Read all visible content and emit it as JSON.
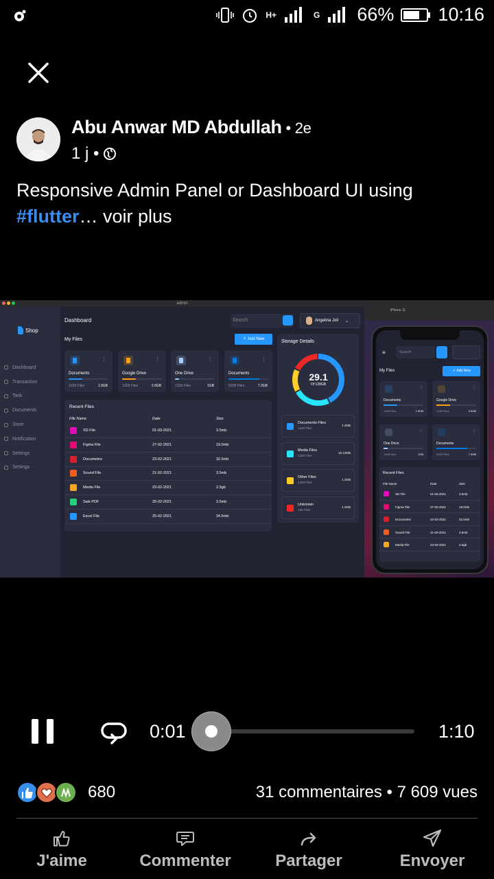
{
  "status_bar": {
    "battery": "66%",
    "time": "10:16",
    "network_1": "H+",
    "network_2": "G"
  },
  "post": {
    "author": "Abu Anwar MD Abdullah",
    "author_suffix": " • 2e",
    "age": "1 j •",
    "caption_text": "Responsive Admin Panel or Dashboard UI using",
    "hashtag": "#flutter",
    "see_more": "… voir plus"
  },
  "video": {
    "window_title": "admin",
    "desktop": {
      "logo": "Shop",
      "sidebar": [
        "Dashboard",
        "Transaction",
        "Task",
        "Documents",
        "Store",
        "Notification",
        "Settings",
        "Settings"
      ],
      "title": "Dashboard",
      "search_placeholder": "Search",
      "profile_name": "Angelina Joli",
      "my_files": "My Files",
      "add_new": "Add New",
      "cards": [
        {
          "name": "Documents",
          "files": "1328 Files",
          "size": "1.9GB",
          "color": "#2697ff",
          "progress": 0.35
        },
        {
          "name": "Google Drive",
          "files": "1328 Files",
          "size": "2.9GB",
          "color": "#ffa113",
          "progress": 0.35
        },
        {
          "name": "One Drive",
          "files": "1328 Files",
          "size": "1GB",
          "color": "#a4cdff",
          "progress": 0.1
        },
        {
          "name": "Documents",
          "files": "5328 Files",
          "size": "7.3GB",
          "color": "#007ee5",
          "progress": 0.78
        }
      ],
      "recent": {
        "title": "Recent Files",
        "headers": [
          "File Name",
          "Date",
          "Size"
        ],
        "rows": [
          {
            "name": "XD File",
            "date": "01-03-2021",
            "size": "3.5mb",
            "color": "#e10db8"
          },
          {
            "name": "Figma File",
            "date": "27-02-2021",
            "size": "19.0mb",
            "color": "#e10d72"
          },
          {
            "name": "Documetns",
            "date": "23-02-2021",
            "size": "32.5mb",
            "color": "#d61f2c"
          },
          {
            "name": "Sound File",
            "date": "21-02-2021",
            "size": "3.5mb",
            "color": "#f05f22"
          },
          {
            "name": "Media File",
            "date": "23-02-2021",
            "size": "2.5gb",
            "color": "#f5a623"
          },
          {
            "name": "Sals PDF",
            "date": "25-02-2021",
            "size": "3.5mb",
            "color": "#26d07c"
          },
          {
            "name": "Excel File",
            "date": "25-02-2021",
            "size": "34.5mb",
            "color": "#2697ff"
          }
        ]
      },
      "storage": {
        "title": "Storage Details",
        "total": "29.1",
        "of": "Of 128GB",
        "items": [
          {
            "name": "Documents Files",
            "files": "1328 Files",
            "size": "1.3GB",
            "color": "#2697ff"
          },
          {
            "name": "Media Files",
            "files": "1328 Files",
            "size": "15.13GB",
            "color": "#26e5ff"
          },
          {
            "name": "Other Files",
            "files": "1328 Files",
            "size": "1.3GB",
            "color": "#ffcf26"
          },
          {
            "name": "Unknown",
            "files": "140 Files",
            "size": "1.3GB",
            "color": "#ee2727"
          }
        ]
      }
    },
    "phone": {
      "header_text": "iPhone 11",
      "search_placeholder": "Search",
      "my_files": "My Files",
      "add_new": "Add New",
      "cards": [
        {
          "name": "Documents",
          "files": "1328 Files",
          "size": "1.9GB",
          "color": "#2697ff",
          "progress": 0.35
        },
        {
          "name": "Google Drive",
          "files": "1328 Files",
          "size": "2.9GB",
          "color": "#ffa113",
          "progress": 0.35
        },
        {
          "name": "One Drive",
          "files": "1328 Files",
          "size": "1GB",
          "color": "#a4cdff",
          "progress": 0.1
        },
        {
          "name": "Documents",
          "files": "5328 Files",
          "size": "7.3GB",
          "color": "#007ee5",
          "progress": 0.78
        }
      ],
      "recent_title": "Recent Files",
      "headers": [
        "File Name",
        "Date",
        "Size"
      ],
      "rows": [
        {
          "name": "XD File",
          "date": "01-03-2021",
          "size": "3.5mb",
          "color": "#e10db8"
        },
        {
          "name": "Figma File",
          "date": "27-02-2021",
          "size": "19.0mb",
          "color": "#e10d72"
        },
        {
          "name": "Documetns",
          "date": "23-02-2021",
          "size": "32.5mb",
          "color": "#d61f2c"
        },
        {
          "name": "Sound File",
          "date": "21-03-2021",
          "size": "3.5mb",
          "color": "#f05f22"
        },
        {
          "name": "Media File",
          "date": "23-02-2021",
          "size": "2.5gb",
          "color": "#f5a623"
        }
      ]
    }
  },
  "player": {
    "current_time": "0:01",
    "total_time": "1:10",
    "progress": 0.014
  },
  "engagement": {
    "reaction_count": "680",
    "comments_views": "31 commentaires • 7 609 vues"
  },
  "actions": {
    "like": "J'aime",
    "comment": "Commenter",
    "share": "Partager",
    "send": "Envoyer"
  },
  "colors": {
    "hashtag": "#3b8cf0",
    "primary": "#2697ff",
    "bg_dark": "#212332",
    "panel": "#2a2d3e"
  }
}
